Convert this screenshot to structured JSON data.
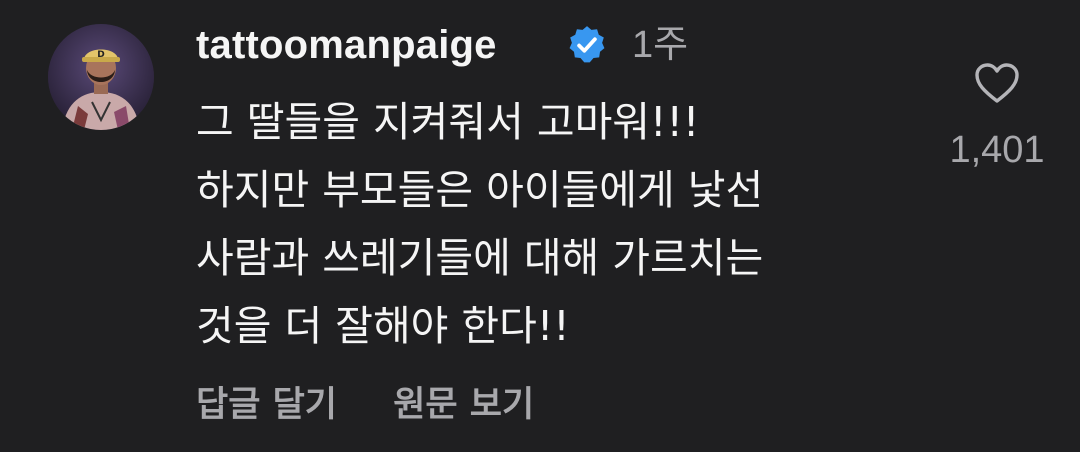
{
  "comment": {
    "username": "tattoomanpaige",
    "verified_icon": "verified-badge-icon",
    "timestamp": "1주",
    "text_lines": [
      "그 딸들을 지켜줘서 고마워!!!",
      "하지만 부모들은 아이들에게 낯선",
      "사람과 쓰레기들에 대해 가르치는",
      "것을 더 잘해야 한다!!"
    ],
    "like_icon": "heart-outline-icon",
    "like_count": "1,401",
    "actions": {
      "reply_label": "답글 달기",
      "translate_label": "원문 보기"
    }
  },
  "colors": {
    "background": "#1f1f21",
    "primary_text": "#f5f5f5",
    "secondary_text": "#a8a8ac",
    "verified_blue": "#3897f0"
  }
}
